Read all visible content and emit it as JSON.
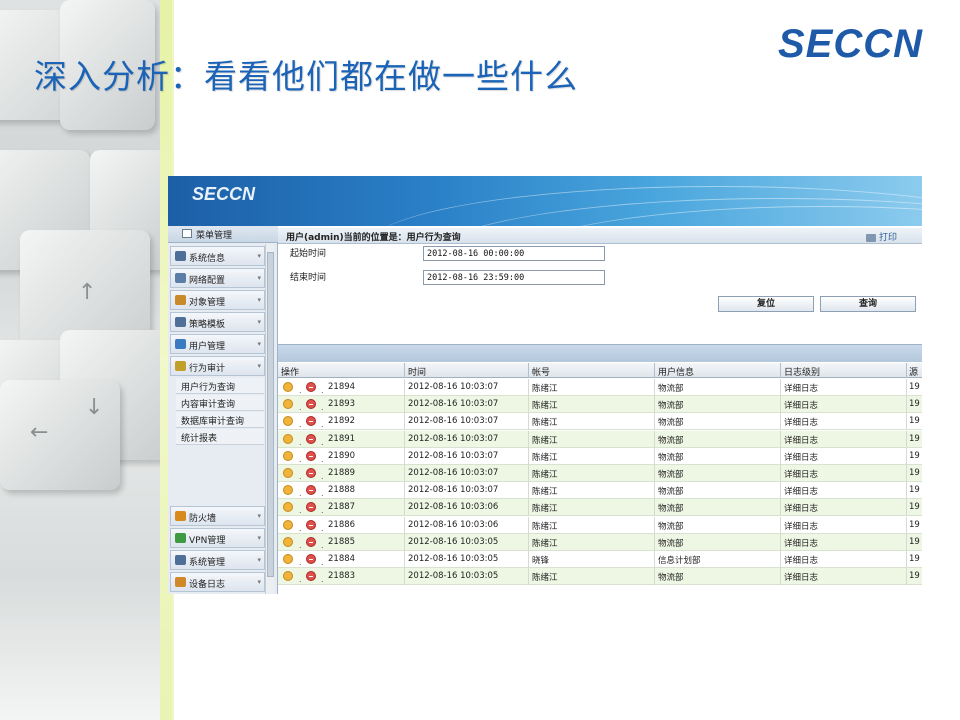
{
  "slide": {
    "title": "深入分析：看看他们都在做一些什么",
    "brand": "SECCN"
  },
  "app": {
    "logo": "SECCN",
    "sidebar": {
      "title": "菜单管理",
      "items": [
        {
          "label": "系统信息",
          "icon_color": "#4d6f98"
        },
        {
          "label": "网络配置",
          "icon_color": "#5a7ea8"
        },
        {
          "label": "对象管理",
          "icon_color": "#c98a2a"
        },
        {
          "label": "策略模板",
          "icon_color": "#4d6f98"
        },
        {
          "label": "用户管理",
          "icon_color": "#3b7bc2"
        },
        {
          "label": "行为审计",
          "icon_color": "#c0a02a"
        }
      ],
      "subitems": [
        "用户行为查询",
        "内容审计查询",
        "数据库审计查询",
        "统计报表"
      ],
      "bottom_items": [
        {
          "label": "防火墙",
          "icon_color": "#d98a1c"
        },
        {
          "label": "VPN管理",
          "icon_color": "#3f9a44"
        },
        {
          "label": "系统管理",
          "icon_color": "#4d6f98"
        },
        {
          "label": "设备日志",
          "icon_color": "#d0882a"
        }
      ]
    },
    "breadcrumb": "用户(admin)当前的位置是：用户行为查询",
    "print_label": "打印",
    "form": {
      "start_label": "起始时间",
      "start_value": "2012-08-16 00:00:00",
      "end_label": "结束时间",
      "end_value": "2012-08-16 23:59:00",
      "reset_label": "复位",
      "query_label": "查询"
    },
    "table": {
      "columns": [
        "操作",
        "时间",
        "帐号",
        "用户信息",
        "日志级别",
        "源"
      ],
      "rows": [
        {
          "id": "21894",
          "time": "2012-08-16 10:03:07",
          "account": "陈绪江",
          "info": "物流部",
          "level": "详细日志",
          "src": "19"
        },
        {
          "id": "21893",
          "time": "2012-08-16 10:03:07",
          "account": "陈绪江",
          "info": "物流部",
          "level": "详细日志",
          "src": "19"
        },
        {
          "id": "21892",
          "time": "2012-08-16 10:03:07",
          "account": "陈绪江",
          "info": "物流部",
          "level": "详细日志",
          "src": "19"
        },
        {
          "id": "21891",
          "time": "2012-08-16 10:03:07",
          "account": "陈绪江",
          "info": "物流部",
          "level": "详细日志",
          "src": "19"
        },
        {
          "id": "21890",
          "time": "2012-08-16 10:03:07",
          "account": "陈绪江",
          "info": "物流部",
          "level": "详细日志",
          "src": "19"
        },
        {
          "id": "21889",
          "time": "2012-08-16 10:03:07",
          "account": "陈绪江",
          "info": "物流部",
          "level": "详细日志",
          "src": "19"
        },
        {
          "id": "21888",
          "time": "2012-08-16 10:03:07",
          "account": "陈绪江",
          "info": "物流部",
          "level": "详细日志",
          "src": "19"
        },
        {
          "id": "21887",
          "time": "2012-08-16 10:03:06",
          "account": "陈绪江",
          "info": "物流部",
          "level": "详细日志",
          "src": "19"
        },
        {
          "id": "21886",
          "time": "2012-08-16 10:03:06",
          "account": "陈绪江",
          "info": "物流部",
          "level": "详细日志",
          "src": "19"
        },
        {
          "id": "21885",
          "time": "2012-08-16 10:03:05",
          "account": "陈绪江",
          "info": "物流部",
          "level": "详细日志",
          "src": "19"
        },
        {
          "id": "21884",
          "time": "2012-08-16 10:03:05",
          "account": "晓锋",
          "info": "信息计划部",
          "level": "详细日志",
          "src": "19"
        },
        {
          "id": "21883",
          "time": "2012-08-16 10:03:05",
          "account": "陈绪江",
          "info": "物流部",
          "level": "详细日志",
          "src": "19"
        }
      ]
    }
  }
}
